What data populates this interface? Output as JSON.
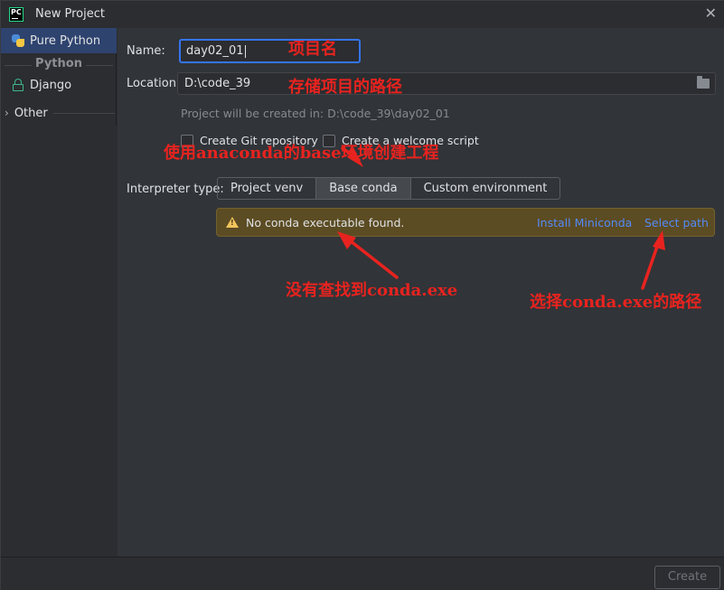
{
  "window": {
    "title": "New Project",
    "icon": "pycharm-logo-icon",
    "icon_text": "PC"
  },
  "sidebar": {
    "items": [
      {
        "label": "Pure Python",
        "icon": "python-icon",
        "selected": true
      },
      {
        "label": "Django",
        "icon": "lock-icon",
        "selected": false
      }
    ],
    "group_label": "Python",
    "other_label": "Other"
  },
  "form": {
    "name_label": "Name:",
    "name_value": "day02_01",
    "location_label": "Location:",
    "location_value": "D:\\code_39",
    "hint": "Project will be created in: D:\\code_39\\day02_01",
    "git_checkbox": "Create Git repository",
    "welcome_checkbox": "Create a welcome script",
    "interpreter_label": "Interpreter type:",
    "interpreter_tabs": [
      "Project venv",
      "Base conda",
      "Custom environment"
    ],
    "interpreter_selected": "Base conda"
  },
  "warning": {
    "text": "No conda executable found.",
    "install_link": "Install Miniconda",
    "select_link": "Select path"
  },
  "footer": {
    "create_label": "Create"
  },
  "annotations": {
    "name": "项目名",
    "location": "存储项目的路径",
    "base_env": "使用anaconda的base环境创建工程",
    "not_found": "没有查找到conda.exe",
    "select_path": "选择conda.exe的路径"
  },
  "colors": {
    "accent": "#3574f0",
    "warning_bg": "#5c4c23",
    "link": "#548af7",
    "annotation": "#e8231f"
  }
}
